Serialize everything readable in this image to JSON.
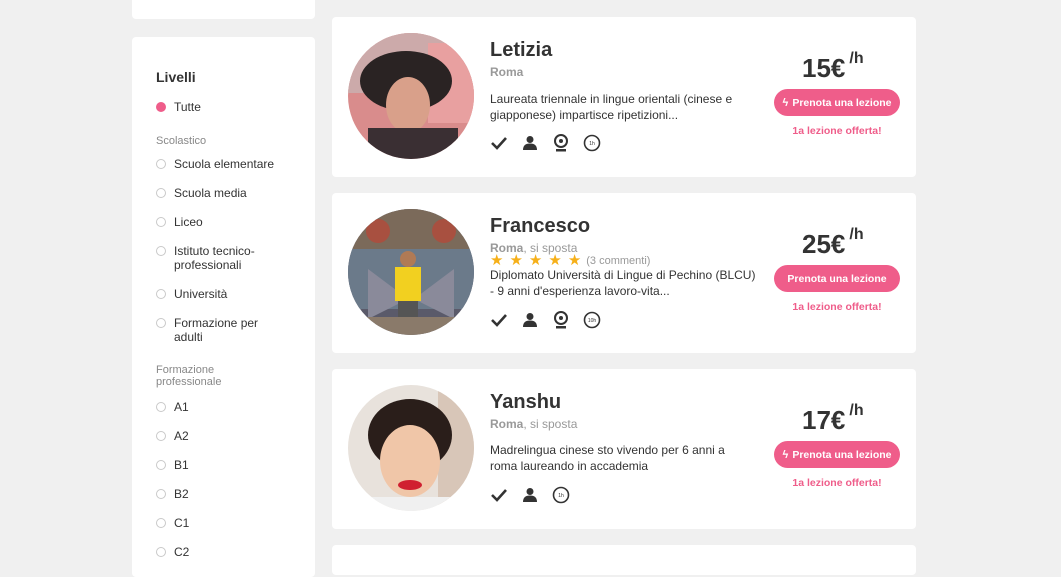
{
  "filters": {
    "title": "Livelli",
    "all_label": "Tutte",
    "groups": [
      {
        "label": "Scolastico",
        "options": [
          "Scuola elementare",
          "Scuola media",
          "Liceo",
          "Istituto tecnico-professionali",
          "Università",
          "Formazione per adulti"
        ]
      },
      {
        "label": "Formazione professionale",
        "options": [
          "A1",
          "A2",
          "B1",
          "B2",
          "C1",
          "C2"
        ]
      }
    ]
  },
  "tutors": [
    {
      "name": "Letizia",
      "city": "Roma",
      "moves": "",
      "reviews": "",
      "description": "Laureata triennale in lingue orientali (cinese e giapponese) impartisce ripetizioni...",
      "price": "15€",
      "unit": "/h",
      "icons": [
        "check-icon",
        "person-icon",
        "webcam-icon",
        "1h-pack-icon"
      ],
      "icon_badge": "1h",
      "book_label": "Prenota una lezione",
      "offer": "1a lezione offerta!"
    },
    {
      "name": "Francesco",
      "city": "Roma",
      "moves": ", si sposta",
      "reviews": "(3 commenti)",
      "rating": 5,
      "description": "Diplomato Università di Lingue di Pechino (BLCU) - 9 anni d'esperienza lavoro-vita...",
      "price": "25€",
      "unit": "/h",
      "icons": [
        "check-icon",
        "person-icon",
        "webcam-icon",
        "10h-pack-icon"
      ],
      "icon_badge": "10h",
      "book_label": "Prenota una lezione",
      "offer": "1a lezione offerta!"
    },
    {
      "name": "Yanshu",
      "city": "Roma",
      "moves": ", si sposta",
      "reviews": "",
      "description": "Madrelingua cinese sto vivendo per 6 anni a roma laureando in accademia",
      "price": "17€",
      "unit": "/h",
      "icons": [
        "check-icon",
        "person-icon",
        "1h-pack-icon"
      ],
      "icon_badge": "1h",
      "book_label": "Prenota una lezione",
      "offer": "1a lezione offerta!"
    }
  ],
  "colors": {
    "accent": "#ef5d8a",
    "star": "#f6b019",
    "background": "#f0f0f0"
  }
}
